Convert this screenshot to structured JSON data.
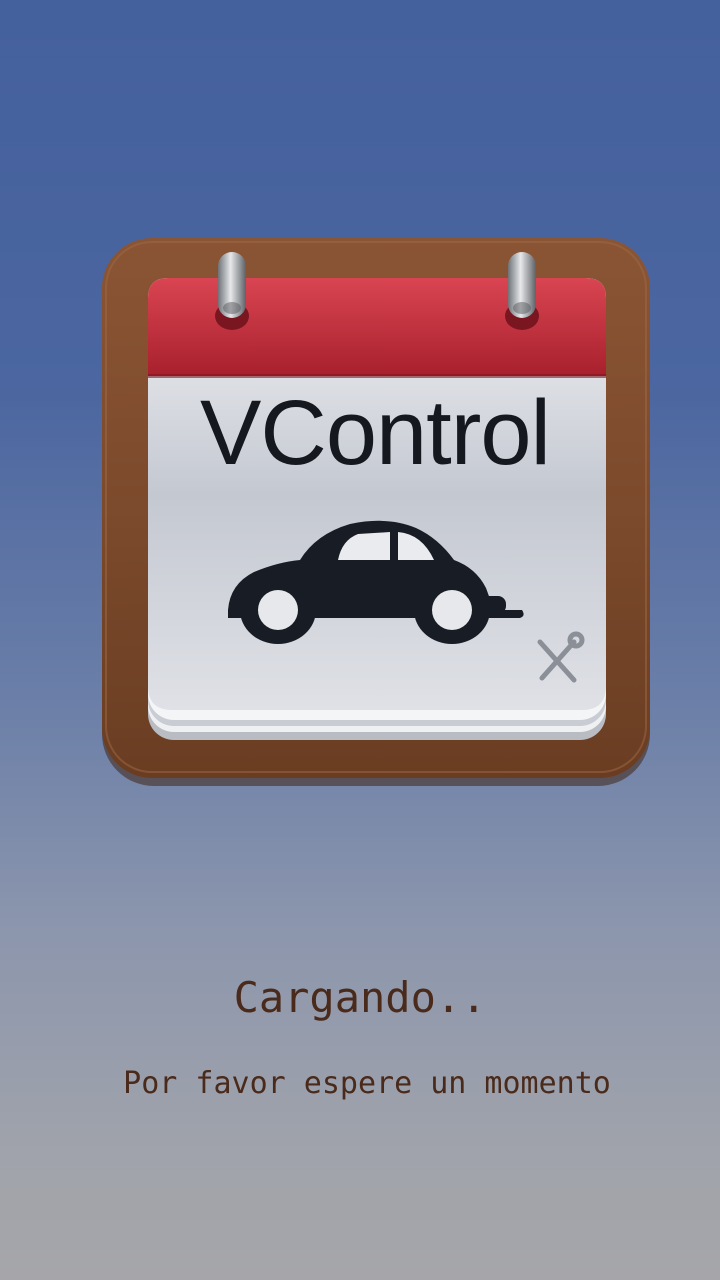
{
  "splash": {
    "app_name": "VControl",
    "loading_title": "Cargando..",
    "loading_subtitle": "Por favor espere un momento"
  },
  "icons": {
    "app_icon": "calendar-car-icon",
    "car": "car-icon",
    "tools": "wrench-screwdriver-icon",
    "rings": "binder-ring-icon"
  },
  "colors": {
    "background_top": "#44609d",
    "background_bottom": "#a6a6aa",
    "wood": "#7a4a2c",
    "calendar_header": "#c2333f",
    "page": "#d4d7de",
    "text_dark": "#15181f",
    "loading_text": "#4a2a1a"
  }
}
